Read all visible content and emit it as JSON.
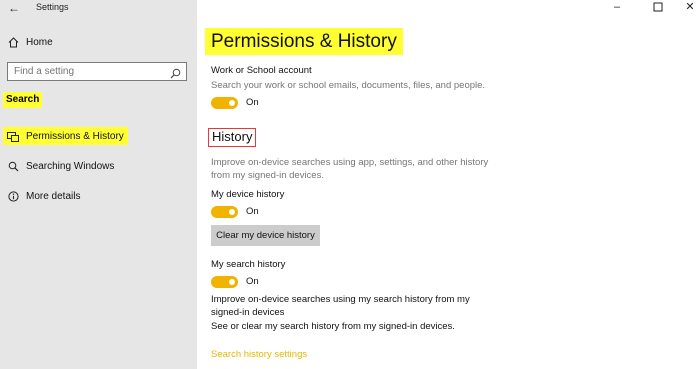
{
  "window": {
    "title": "Settings",
    "controls": [
      "minimize",
      "maximize",
      "close"
    ]
  },
  "sidebar": {
    "home_label": "Home",
    "search_placeholder": "Find a setting",
    "section_label": "Search",
    "items": [
      {
        "label": "Permissions & History",
        "icon": "permissions-icon",
        "active": true
      },
      {
        "label": "Searching Windows",
        "icon": "search-icon"
      },
      {
        "label": "More details",
        "icon": "info-icon"
      }
    ]
  },
  "main": {
    "title": "Permissions & History",
    "work_account": {
      "label": "Work or School account",
      "description": "Search your work or school emails, documents, files, and people.",
      "toggle_state": "On"
    },
    "history": {
      "heading": "History",
      "description_line1": "Improve on-device searches using app, settings, and other history",
      "description_line2": "from my signed-in devices.",
      "device_history": {
        "label": "My device history",
        "toggle_state": "On",
        "clear_button": "Clear my device history"
      },
      "search_history": {
        "label": "My search history",
        "toggle_state": "On",
        "desc_line1": "Improve on-device searches using my search history from my",
        "desc_line2": "signed-in devices",
        "desc_line3": "See or clear my search history from my signed-in devices.",
        "link": "Search history settings"
      }
    }
  },
  "colors": {
    "accent": "#f0b400",
    "highlight": "#ffff33",
    "sidebar_bg": "#e6e6e6",
    "outline": "#e53935",
    "link": "#e6b800"
  }
}
